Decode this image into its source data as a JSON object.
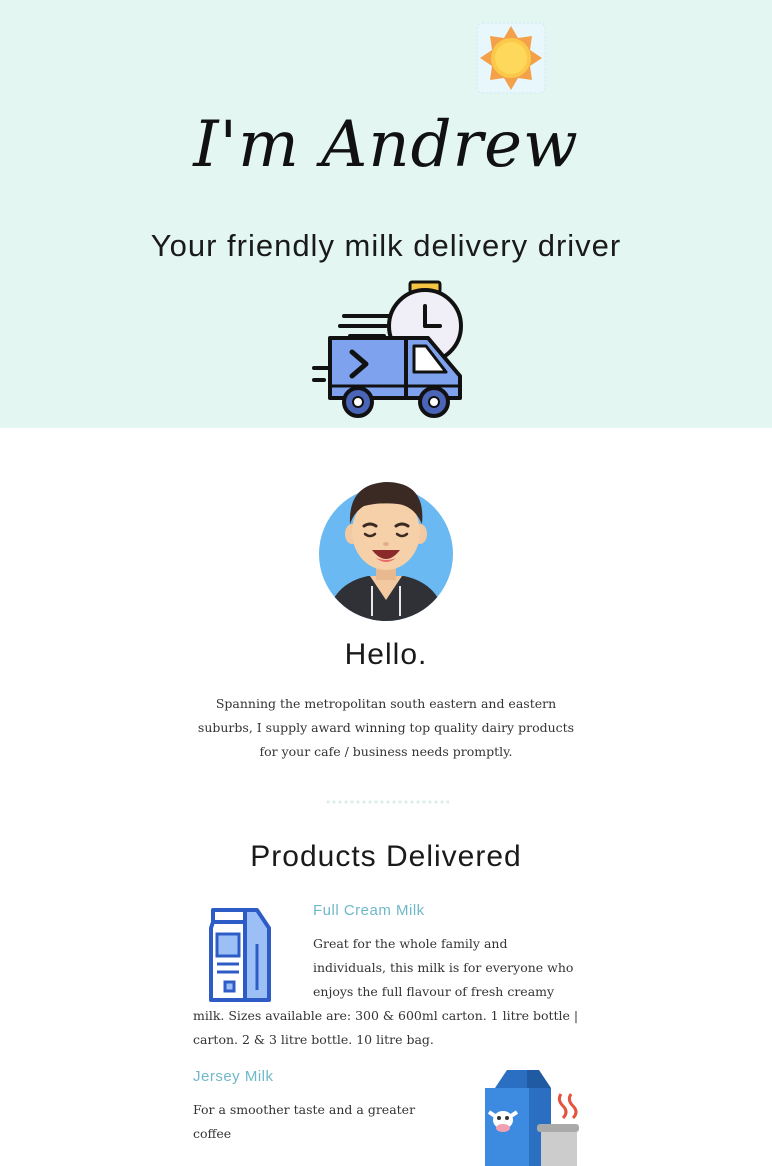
{
  "hero": {
    "title": "I'm Andrew",
    "subtitle": "Your friendly milk delivery driver",
    "icons": [
      "sun-icon",
      "delivery-truck-icon"
    ]
  },
  "about": {
    "heading": "Hello.",
    "text": "Spanning the metropolitan south eastern and eastern suburbs, I supply award winning top quality dairy products for your cafe / business needs promptly.",
    "avatar": "avatar-illustration"
  },
  "products": {
    "heading": "Products Delivered",
    "items": [
      {
        "name": "Full Cream Milk",
        "description": "Great for the whole family and individuals, this milk is for everyone who enjoys the full flavour of fresh creamy milk. Sizes available are: 300 & 600ml carton. 1 litre bottle | carton. 2 & 3 litre bottle. 10 litre bag.",
        "icon": "milk-carton-icon"
      },
      {
        "name": "Jersey Milk",
        "description": "For a smoother taste and a greater coffee",
        "icon": "jersey-milk-carton-icon"
      }
    ]
  },
  "colors": {
    "hero_bg": "#e3f6f1",
    "accent": "#6fb8c9",
    "text": "#333333"
  }
}
